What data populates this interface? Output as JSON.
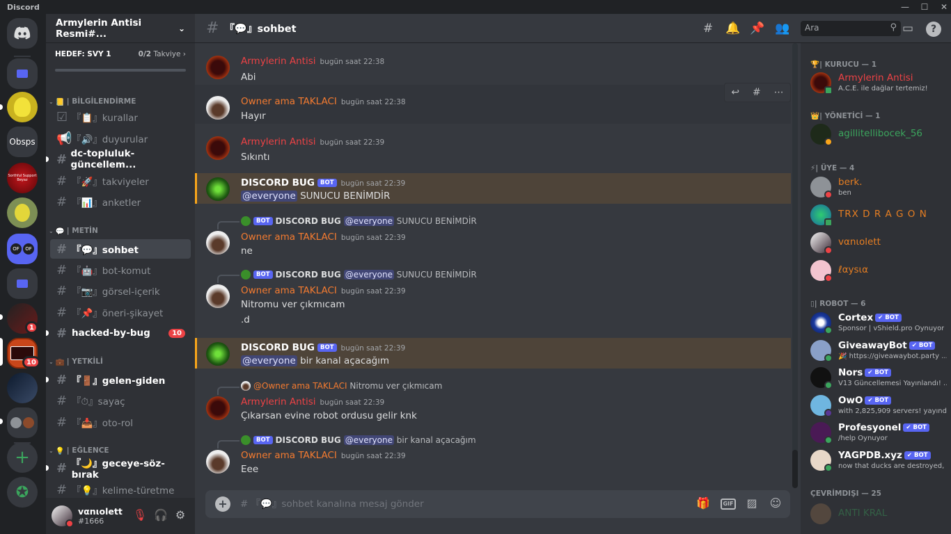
{
  "app": {
    "title": "Discord"
  },
  "server": {
    "name": "Armylerin Antisi Resmi#...",
    "goal_label": "HEDEF: SVY 1",
    "goal_progress": "0/2",
    "goal_boost": "Takviye",
    "goal_fraction": 0
  },
  "guilds": {
    "obs_label": "Obsps",
    "badge_a": "1",
    "badge_b": "10",
    "support_text": "Sorthful Support Beyaz"
  },
  "categories": {
    "info": "| BİLGİLENDİRME",
    "text": "| METİN",
    "staff": "| YETKİLİ",
    "fun": "| EĞLENCE"
  },
  "channels": [
    {
      "name": "『📋』kurallar"
    },
    {
      "name": "『🔊』duyurular"
    },
    {
      "name": "dc-topluluk-güncellem..."
    },
    {
      "name": "『🚀』takviyeler"
    },
    {
      "name": "『📊』anketler"
    },
    {
      "name": "『💬』sohbet"
    },
    {
      "name": "『🤖』bot-komut"
    },
    {
      "name": "『📷』görsel-içerik"
    },
    {
      "name": "『📌』öneri-şikayet"
    },
    {
      "name": "hacked-by-bug",
      "count": "10"
    },
    {
      "name": "『🚪』gelen-giden"
    },
    {
      "name": "『⏱』sayaç"
    },
    {
      "name": "『📥』oto-rol"
    },
    {
      "name": "『🌙』geceye-söz-bırak"
    },
    {
      "name": "『💡』kelime-türetme"
    }
  ],
  "user": {
    "name": "vαnιolett",
    "tag": "#1666"
  },
  "chat": {
    "channel_title": "『💬』sohbet",
    "search_placeholder": "Ara",
    "composer_placeholder": "# 『💬』sohbet kanalına mesaj gönder",
    "bot_label": "BOT",
    "gif_label": "GIF"
  },
  "messages": [
    {
      "author": "Armylerin Antisi",
      "time": "bugün saat 22:38",
      "text": "Abi",
      "color": "#ed4245"
    },
    {
      "author": "Owner ama TAKLACI",
      "time": "bugün saat 22:38",
      "text": "Hayır",
      "color": "#f47b30"
    },
    {
      "author": "Armylerin Antisi",
      "time": "bugün saat 22:39",
      "text": "Sıkıntı",
      "color": "#ed4245"
    },
    {
      "author": "DISCORD BUG",
      "time": "bugün saat 22:39",
      "mention": "@everyone",
      "text": "SUNUCU BENİMDİR",
      "color": "#ffffff"
    },
    {
      "reply_author": "DISCORD BUG",
      "reply_mention": "@everyone",
      "reply_text": "SUNUCU BENİMDİR",
      "author": "Owner ama TAKLACI",
      "time": "bugün saat 22:39",
      "text": "ne",
      "color": "#f47b30"
    },
    {
      "reply_author": "DISCORD BUG",
      "reply_mention": "@everyone",
      "reply_text": "SUNUCU BENİMDİR",
      "author": "Owner ama TAKLACI",
      "time": "bugün saat 22:39",
      "text": "Nitromu ver çıkmıcam",
      "text2": ".d",
      "color": "#f47b30"
    },
    {
      "author": "DISCORD BUG",
      "time": "bugün saat 22:39",
      "mention": "@everyone",
      "text": "bir kanal açacağım",
      "color": "#ffffff"
    },
    {
      "reply_author": "@Owner ama TAKLACI",
      "reply_text": "Nitromu ver çıkmıcam",
      "author": "Armylerin Antisi",
      "time": "bugün saat 22:39",
      "text": "Çıkarsan evine robot ordusu gelir knk",
      "color": "#ed4245"
    },
    {
      "reply_author": "DISCORD BUG",
      "reply_mention": "@everyone",
      "reply_text": "bir kanal açacağım",
      "author": "Owner ama TAKLACI",
      "time": "bugün saat 22:39",
      "text": "Eee",
      "color": "#f47b30"
    }
  ],
  "members": {
    "founder_cat": "| KURUCU — 1",
    "admin_cat": "| YÖNETİCİ — 1",
    "member_cat": "| ÜYE — 4",
    "robot_cat": "| ROBOT — 6",
    "offline_cat": "ÇEVRİMDIŞI — 25",
    "founder": {
      "name": "Armylerin Antisi",
      "sub": "A.C.E. ile dağlar tertemiz!",
      "color": "#ed4245"
    },
    "admin": {
      "name": "agillitellibocek_56",
      "color": "#3ba55d"
    },
    "users": [
      {
        "name": "berk.",
        "sub": "ben",
        "color": "#e67e22"
      },
      {
        "name": "TRX D R A G O N",
        "color": "#e67e22"
      },
      {
        "name": "vαnιolett",
        "color": "#e67e22"
      },
      {
        "name": "ℓαуѕια",
        "color": "#e67e22"
      }
    ],
    "bots": [
      {
        "name": "Cortex",
        "sub": "Sponsor | vShield.pro Oynuyor"
      },
      {
        "name": "GiveawayBot",
        "sub": "🎉 https://giveawaybot.party ..."
      },
      {
        "name": "Nors",
        "sub": "V13 Güncellemesi Yayınlandı! ..."
      },
      {
        "name": "OwO",
        "sub": "with 2,825,909 servers! yayında"
      },
      {
        "name": "Profesyonel",
        "sub": "/help Oynuyor"
      },
      {
        "name": "YAGPDB.xyz",
        "sub": "now that ducks are destroyed, ..."
      }
    ],
    "offline": {
      "name": "ANTI KRAL",
      "color": "#3ba55d"
    }
  }
}
